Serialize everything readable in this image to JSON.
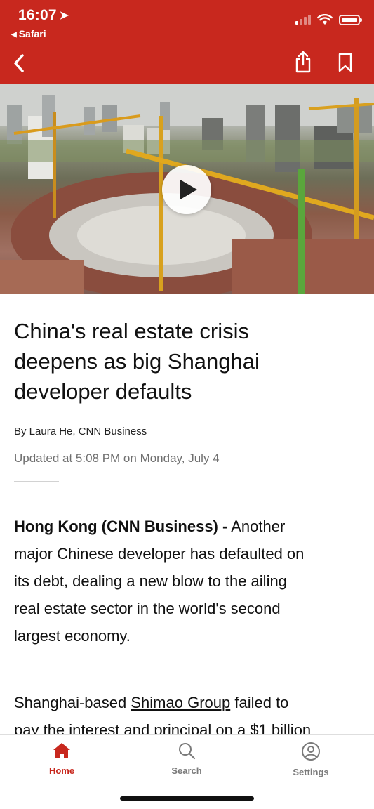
{
  "status_bar": {
    "time": "16:07",
    "back_app": "Safari"
  },
  "icons": {
    "location": "location-arrow-icon",
    "back": "chevron-left-icon",
    "share": "share-icon",
    "bookmark": "bookmark-icon",
    "play": "play-icon",
    "home": "home-icon",
    "search": "search-icon",
    "settings": "settings-icon"
  },
  "colors": {
    "brand_red": "#c8281e",
    "inactive_tab": "#7a7a7a"
  },
  "article": {
    "headline_lines": [
      "China's real estate crisis",
      "deepens as big Shanghai",
      "developer defaults"
    ],
    "byline": "By Laura He, CNN Business",
    "updated": "Updated at 5:08 PM on Monday, July 4",
    "para1": {
      "dateline": "Hong Kong  (CNN Business) -",
      "lines": [
        "Another",
        "major Chinese developer has defaulted on",
        "its debt, dealing a new blow to the ailing",
        "real estate sector in the world's second",
        "largest economy."
      ]
    },
    "para2": {
      "prefix": "Shanghai-based",
      "link": "Shimao Group",
      "suffix": "failed to",
      "line2": "pay the interest and principal on a $1 billion"
    }
  },
  "tabbar": {
    "home": "Home",
    "search": "Search",
    "settings": "Settings",
    "active": "Home"
  }
}
